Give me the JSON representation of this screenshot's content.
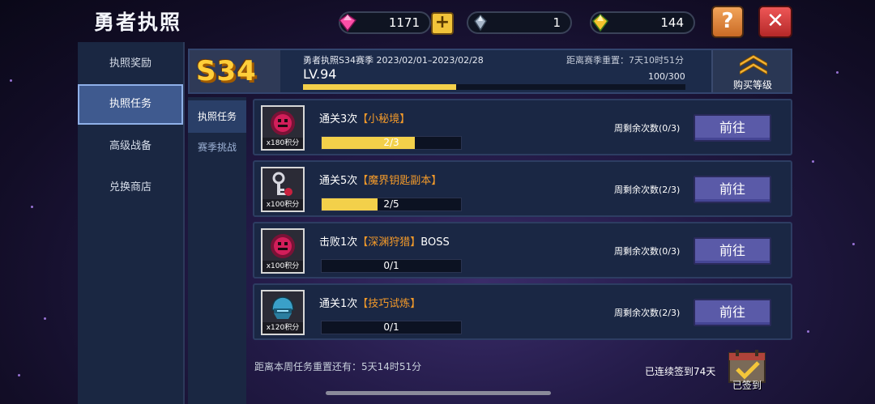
{
  "app": {
    "title": "勇者执照"
  },
  "resources": {
    "gems": "1171",
    "crystals": "1",
    "gold": "144",
    "plus_label": "+",
    "help_label": "?",
    "close_label": "✕"
  },
  "sidebar": {
    "items": [
      {
        "label": "执照奖励"
      },
      {
        "label": "执照任务"
      },
      {
        "label": "高级战备"
      },
      {
        "label": "兑换商店"
      }
    ]
  },
  "season": {
    "badge": "S34",
    "name_dates": "勇者执照S34赛季 2023/02/01–2023/02/28",
    "countdown": "距离赛季重置：7天10时51分",
    "level": "LV.94",
    "xp_text": "100/300",
    "xp_fraction": 0.4,
    "buy_label": "购买等级"
  },
  "subtabs": [
    {
      "label": "执照任务"
    },
    {
      "label": "赛季挑战"
    }
  ],
  "tasks": [
    {
      "pts": "x180积分",
      "desc_pre": "通关3次",
      "desc_hl": "【小秘境】",
      "desc_post": "",
      "progress": "2/3",
      "fraction": 0.667,
      "remain": "周剩余次数(0/3)",
      "button": "前往",
      "icon": "red-monster-icon"
    },
    {
      "pts": "x100积分",
      "desc_pre": "通关5次",
      "desc_hl": "【魔界钥匙副本】",
      "desc_post": "",
      "progress": "2/5",
      "fraction": 0.4,
      "remain": "周剩余次数(2/3)",
      "button": "前往",
      "icon": "key-icon"
    },
    {
      "pts": "x100积分",
      "desc_pre": "击败1次",
      "desc_hl": "【深渊狩猎】",
      "desc_post": "BOSS",
      "progress": "0/1",
      "fraction": 0,
      "remain": "周剩余次数(0/3)",
      "button": "前往",
      "icon": "red-monster-icon"
    },
    {
      "pts": "x120积分",
      "desc_pre": "通关1次",
      "desc_hl": "【技巧试炼】",
      "desc_post": "",
      "progress": "0/1",
      "fraction": 0,
      "remain": "周剩余次数(2/3)",
      "button": "前往",
      "icon": "blue-helmet-icon"
    }
  ],
  "footer": {
    "weekly_reset": "距离本周任务重置还有：5天14时51分",
    "checkin_streak": "已连续签到74天",
    "checkin_label": "已签到"
  },
  "colors": {
    "accent_yellow": "#f3d04a",
    "highlight_orange": "#f39a2a",
    "button_purple": "#5a5aa8",
    "panel_blue": "#1a2744"
  }
}
